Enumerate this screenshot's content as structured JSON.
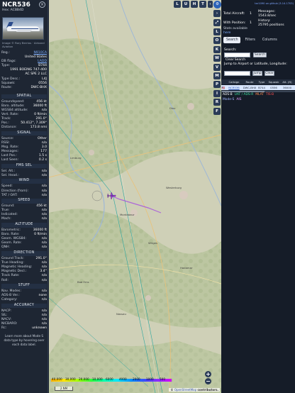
{
  "aircraft": {
    "callsign": "NCR536",
    "hex_line": "Hex:  ACBB4D",
    "photo_credit": "Image © Rory Berrios · Airband Aviation",
    "rows": [
      {
        "k": "Reg.:",
        "v": "N910CA",
        "link": true
      },
      {
        "k": "",
        "v": "United States"
      },
      {
        "k": "DB flags:",
        "v": "LADD",
        "link": true
      },
      {
        "k": "Type:",
        "v": "B744"
      },
      {
        "k": "",
        "v": "1991 BOEING 747-400"
      },
      {
        "k": "",
        "v": "AC SPE 2 LLC"
      },
      {
        "k": "Type Desc.:",
        "v": "L4J"
      },
      {
        "k": "Squawk:",
        "v": "0556"
      },
      {
        "k": "Route:",
        "v": "DWC-BHX"
      }
    ]
  },
  "sections": [
    {
      "title": "SPATIAL",
      "rows": [
        {
          "k": "Groundspeed:",
          "v": "456 kt"
        },
        {
          "k": "Baro. altitude:",
          "v": "36000 ft"
        },
        {
          "k": "WGS84 altitude:",
          "v": "n/a"
        },
        {
          "k": "Vert. Rate:",
          "v": "0 ft/min"
        },
        {
          "k": "Track:",
          "v": "291.0°"
        },
        {
          "k": "Pos.:",
          "v": "50.412°, 7.309°"
        },
        {
          "k": "Distance:",
          "v": "173.8 nmi"
        }
      ]
    },
    {
      "title": "SIGNAL",
      "rows": [
        {
          "k": "Source:",
          "v": "Other"
        },
        {
          "k": "RSSI:",
          "v": "n/a"
        },
        {
          "k": "Msg. Rate:",
          "v": "3.0"
        },
        {
          "k": "Messages:",
          "v": "177"
        },
        {
          "k": "",
          "v": ""
        },
        {
          "k": "Last Pos.:",
          "v": "1.5 s"
        },
        {
          "k": "Last Seen:",
          "v": "0.2 s"
        }
      ]
    },
    {
      "title": "FMS SEL",
      "rows": [
        {
          "k": "Sel. Alt.:",
          "v": "n/a"
        },
        {
          "k": "Sel. Head.:",
          "v": "n/a"
        }
      ]
    },
    {
      "title": "WIND",
      "rows": [
        {
          "k": "Speed:",
          "v": "n/a"
        },
        {
          "k": "Direction (from):",
          "v": "n/a"
        },
        {
          "k": "TAT / OAT:",
          "v": "n/a"
        }
      ]
    },
    {
      "title": "SPEED",
      "rows": [
        {
          "k": "Ground:",
          "v": "456 kt"
        },
        {
          "k": "True:",
          "v": "n/a"
        },
        {
          "k": "Indicated:",
          "v": "n/a"
        },
        {
          "k": "Mach:",
          "v": "n/a"
        }
      ]
    },
    {
      "title": "ALTITUDE",
      "rows": [
        {
          "k": "Barometric:",
          "v": "36000 ft"
        },
        {
          "k": "Baro. Rate:",
          "v": "0 ft/min"
        },
        {
          "k": "Geom. WGS84:",
          "v": "n/a"
        },
        {
          "k": "Geom. Rate:",
          "v": "n/a"
        },
        {
          "k": "QNH:",
          "v": "n/a"
        }
      ]
    },
    {
      "title": "DIRECTION",
      "rows": [
        {
          "k": "Ground Track:",
          "v": "291.0°"
        },
        {
          "k": "True Heading:",
          "v": "n/a"
        },
        {
          "k": "Magnetic Heading:",
          "v": "n/a"
        },
        {
          "k": "Magnetic Decl.:",
          "v": "3.4°"
        },
        {
          "k": "Track Rate:",
          "v": "n/a"
        },
        {
          "k": "Roll:",
          "v": "n/a"
        }
      ]
    },
    {
      "title": "STUFF",
      "rows": [
        {
          "k": "Nav. Modes:",
          "v": "n/a"
        },
        {
          "k": "ADS-B Ver.:",
          "v": "none"
        },
        {
          "k": "Category:",
          "v": "n/a"
        }
      ]
    },
    {
      "title": "ACCURACY",
      "rows": [
        {
          "k": "NACP:",
          "v": "n/a"
        },
        {
          "k": "SIL:",
          "v": "n/a"
        },
        {
          "k": "NACV:",
          "v": "n/a"
        },
        {
          "k": "NICBARO:",
          "v": "n/a"
        },
        {
          "k": "Rc:",
          "v": "unknown"
        }
      ]
    }
  ],
  "footnote": "Learn more about Mode S data type by hovering over each data label.",
  "map": {
    "top_buttons": [
      "L",
      "U",
      "H",
      "T"
    ],
    "zoom_in": "+",
    "zoom_out": "−",
    "scale_labels": [
      "40,000",
      "30,000",
      "20,000",
      "10,000",
      "6000",
      "4000",
      "2000",
      "1000",
      "500"
    ],
    "km": "2 NM",
    "attribution_prefix": "© ",
    "attribution_link": "OpenStreetMap",
    "attribution_suffix": " contributors.",
    "towns": [
      "Montabaur",
      "Wirges",
      "Westerburg",
      "Hadamar",
      "Limburg",
      "Bad Ems",
      "Nassau",
      "Diez"
    ]
  },
  "tools": [
    "L",
    "O",
    "K",
    "W",
    "V",
    "M",
    "P",
    "I",
    "R",
    "F"
  ],
  "right": {
    "version": "tar1090 on github (3.14.1703)",
    "total_label": "Total Aircraft:",
    "total_value": "1",
    "messages_label": "Messages:",
    "messages_value": "1543.8/sec",
    "position_label": "With Position:",
    "position_value": "1",
    "history_label": "History:",
    "history_value": "25795 positions",
    "stats_label": "Stats available",
    "stats_link": "here",
    "tabs": [
      "Search",
      "Filters",
      "Columns"
    ],
    "search_label": "Search:",
    "search_button": "Search",
    "clear_button": "Clear Search",
    "jump_label": "Jump to Airport or Latitude, Longitude:",
    "jump_button": "Jump",
    "clear2_button": "Clear",
    "columns": [
      "Callsign",
      "Route",
      "Type",
      "Squawk",
      "Alt. (ft)"
    ],
    "row": {
      "flag": "🇺🇸",
      "callsign": "NCR536",
      "route": "DWC-BHX",
      "type": "B744",
      "squawk": "0556",
      "alt": "36000"
    },
    "legend": [
      {
        "text": "ADS-B",
        "color": "#ffffff"
      },
      {
        "text": "UAT / ADS-R",
        "color": "#3ee0a0"
      },
      {
        "text": "MLAT",
        "color": "#ff8a4d"
      },
      {
        "text": "TIS-B",
        "color": "#ff5050"
      },
      {
        "text": "Mode-S",
        "color": "#a0b7ff"
      },
      {
        "text": "AIS",
        "color": "#e6a0ff"
      }
    ]
  },
  "colors": {
    "accent": "#2a3b57",
    "track": "#2aa7a0",
    "aircraft": "#a44ce0"
  }
}
